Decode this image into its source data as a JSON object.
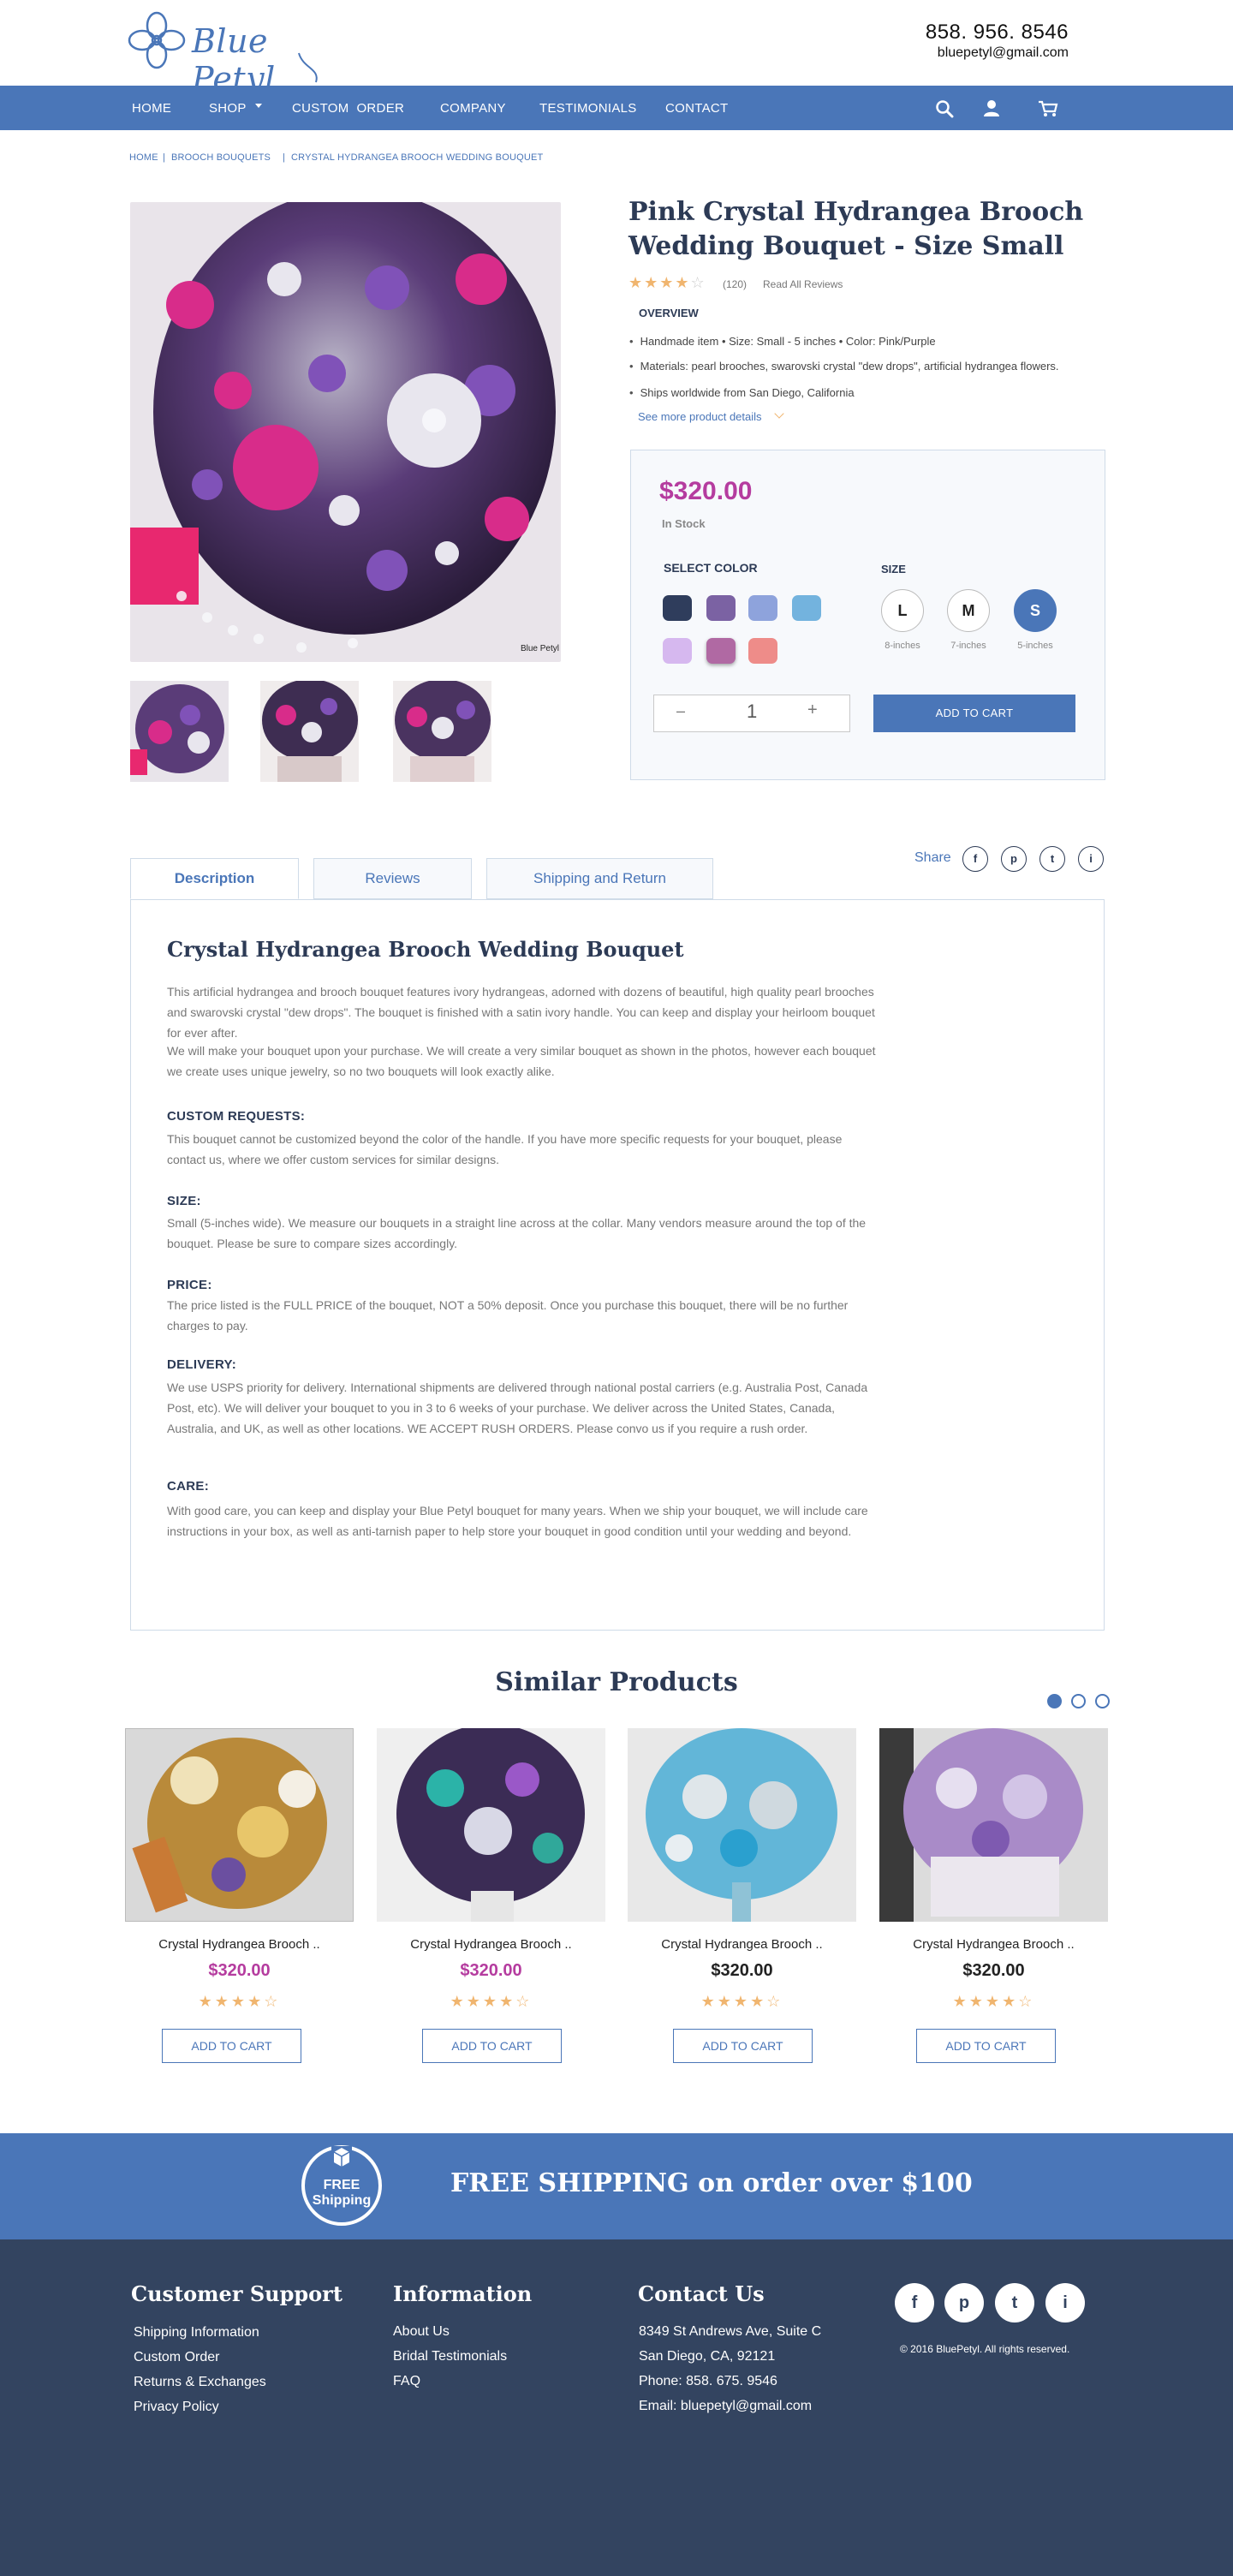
{
  "header": {
    "logo_text": "Blue Petyl",
    "phone": "858. 956. 8546",
    "email": "bluepetyl@gmail.com"
  },
  "nav": {
    "items": [
      "HOME",
      "SHOP",
      "CUSTOM  ORDER",
      "COMPANY",
      "TESTIMONIALS",
      "CONTACT"
    ]
  },
  "breadcrumb": [
    "HOME",
    "BROOCH BOUQUETS",
    "CRYSTAL HYDRANGEA BROOCH WEDDING BOUQUET"
  ],
  "product": {
    "title": "Pink Crystal Hydrangea Brooch Wedding Bouquet - Size Small",
    "rating": 4,
    "review_count": "(120)",
    "read_reviews": "Read All Reviews",
    "image_watermark": "Blue Petyl",
    "overview_label": "OVERVIEW",
    "bullets": [
      "Handmade item  •  Size: Small - 5 inches   •  Color: Pink/Purple",
      "Materials: pearl brooches, swarovski crystal \"dew drops\", artificial hydrangea  flowers.",
      "Ships worldwide from San Diego, California"
    ],
    "more_link": "See more product details",
    "price": "$320.00",
    "stock": "In Stock",
    "select_color_label": "SELECT COLOR",
    "colors": [
      "#2f3d5c",
      "#7b62a3",
      "#8ea3dc",
      "#73b3de",
      "#d6b8ef",
      "#b069a3",
      "#ee8c89"
    ],
    "size_label": "SIZE",
    "sizes": [
      {
        "code": "L",
        "label": "8-inches"
      },
      {
        "code": "M",
        "label": "7-inches"
      },
      {
        "code": "S",
        "label": "5-inches"
      }
    ],
    "selected_size": "S",
    "qty_minus": "–",
    "qty_value": "1",
    "qty_plus": "+",
    "add_to_cart": "ADD TO CART"
  },
  "tabs": [
    "Description",
    "Reviews",
    "Shipping and Return"
  ],
  "share": {
    "label": "Share",
    "icons": [
      "f",
      "p",
      "t",
      "i"
    ]
  },
  "description": {
    "title": "Crystal Hydrangea Brooch Wedding Bouquet",
    "intro": "This artificial hydrangea and brooch bouquet features ivory hydrangeas, adorned with dozens of beautiful, high quality pearl brooches and swarovski crystal \"dew drops\". The bouquet is finished with a satin ivory handle. You can keep and display your heirloom bouquet for ever after.",
    "intro2": "We will make your bouquet upon your purchase. We will create a very similar bouquet as shown in the photos, however each bouquet we create uses unique jewelry, so no two bouquets will look exactly alike.",
    "sections": [
      {
        "heading": "CUSTOM REQUESTS:",
        "text": "This bouquet cannot be customized beyond the color of the handle. If you have more specific requests for your bouquet, please contact us, where we offer custom services for similar designs."
      },
      {
        "heading": "SIZE:",
        "text": "Small (5-inches wide). We measure our bouquets in a straight line across at the collar. Many vendors measure around the top of the bouquet. Please be sure to compare sizes accordingly."
      },
      {
        "heading": "PRICE:",
        "text": "The price listed is the FULL PRICE of the bouquet, NOT a 50% deposit. Once you purchase this bouquet, there will be no further charges to pay."
      },
      {
        "heading": "DELIVERY:",
        "text": "We use USPS priority for delivery. International shipments are delivered through national postal carriers (e.g. Australia Post, Canada Post, etc). We will deliver your bouquet to you in 3 to 6 weeks of your purchase. We deliver across the United States, Canada, Australia, and UK, as well as other locations. WE ACCEPT RUSH ORDERS. Please convo us if you require a rush order."
      },
      {
        "heading": "CARE:",
        "text": "With good care, you can keep and display your Blue Petyl bouquet for many years. When we ship your bouquet, we will include care instructions in your box, as well as anti-tarnish paper to help store your bouquet in good condition until your wedding and beyond."
      }
    ]
  },
  "similar": {
    "title": "Similar Products",
    "items": [
      {
        "name": "Crystal Hydrangea Brooch ..",
        "price": "$320.00",
        "price_color": "#b53c9f",
        "stars": "★★★★☆",
        "button": "ADD TO CART"
      },
      {
        "name": "Crystal Hydrangea Brooch ..",
        "price": "$320.00",
        "price_color": "#b53c9f",
        "stars": "★★★★☆",
        "button": "ADD TO CART"
      },
      {
        "name": "Crystal Hydrangea Brooch ..",
        "price": "$320.00",
        "price_color": "#222222",
        "stars": "★★★★☆",
        "button": "ADD TO CART"
      },
      {
        "name": "Crystal Hydrangea Brooch ..",
        "price": "$320.00",
        "price_color": "#222222",
        "stars": "★★★★☆",
        "button": "ADD TO CART"
      }
    ]
  },
  "banner": {
    "badge_line1": "FREE",
    "badge_line2": "Shipping",
    "text": "FREE SHIPPING on order over $100"
  },
  "footer": {
    "support_title": "Customer Support",
    "support_links": [
      "Shipping Information",
      "Custom Order",
      "Returns & Exchanges",
      "Privacy Policy"
    ],
    "info_title": "Information",
    "info_links": [
      "About Us",
      "Bridal Testimonials",
      "FAQ"
    ],
    "contact_title": "Contact Us",
    "contact_lines": [
      "8349 St Andrews Ave, Suite C",
      "San Diego, CA, 92121",
      "Phone: 858. 675. 9546",
      "Email: bluepetyl@gmail.com"
    ],
    "social_icons": [
      "f",
      "p",
      "t",
      "i"
    ],
    "copyright": "© 2016 BluePetyl. All rights reserved."
  }
}
